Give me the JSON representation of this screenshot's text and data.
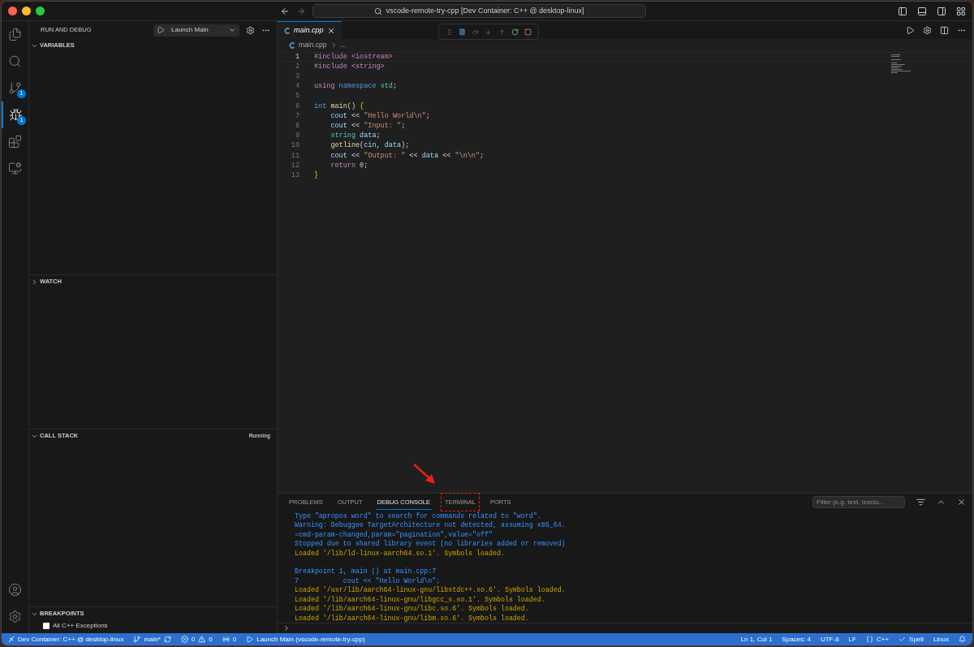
{
  "title_bar": {
    "command_center": "vscode-remote-try-cpp [Dev Container: C++ @ desktop-linux]"
  },
  "activity_bar": [
    {
      "kind": "files",
      "selected": false
    },
    {
      "kind": "search",
      "selected": false
    },
    {
      "kind": "source_control",
      "selected": false,
      "badge": "1"
    },
    {
      "kind": "run_debug",
      "selected": true,
      "badge": "1"
    },
    {
      "kind": "extensions",
      "selected": false
    },
    {
      "kind": "remote",
      "selected": false
    }
  ],
  "sidebar": {
    "title": "RUN AND DEBUG",
    "launch_config": "Launch Main",
    "sections": [
      {
        "title": "VARIABLES",
        "expanded": true,
        "kind": "variables"
      },
      {
        "title": "WATCH",
        "expanded": false,
        "kind": "watch"
      },
      {
        "title": "CALL STACK",
        "expanded": true,
        "kind": "callstack",
        "status": "Running"
      },
      {
        "title": "BREAKPOINTS",
        "expanded": true,
        "kind": "breakpoints",
        "items": [
          {
            "label": "All C++ Exceptions",
            "checked": false
          }
        ]
      }
    ]
  },
  "editor": {
    "tabs": [
      {
        "label": "main.cpp",
        "selected": true
      }
    ],
    "breadcrumb": [
      "main.cpp",
      "..."
    ],
    "lines": [
      {
        "number": "1",
        "current": true,
        "tokens": [
          {
            "text": "#include <iostream>",
            "kind": "pre"
          }
        ]
      },
      {
        "number": "2",
        "current": false,
        "tokens": [
          {
            "text": "#include <string>",
            "kind": "pre"
          }
        ]
      },
      {
        "number": "3",
        "current": false
      },
      {
        "number": "4",
        "current": false,
        "tokens": [
          {
            "text": "using",
            "kind": "ctl"
          },
          {
            "text": " namespace",
            "kind": "kw"
          },
          {
            "text": " std",
            "kind": "type"
          },
          {
            "text": ";",
            "kind": "plain"
          }
        ]
      },
      {
        "number": "5",
        "current": false
      },
      {
        "number": "6",
        "current": false,
        "tokens": [
          {
            "text": "int",
            "kind": "kw"
          },
          {
            "text": " main",
            "kind": "fn"
          },
          {
            "text": "() ",
            "kind": "plain"
          },
          {
            "text": "{",
            "kind": "brace"
          }
        ]
      },
      {
        "number": "7",
        "current": false,
        "tokens": [
          {
            "text": "    cout",
            "kind": "var"
          },
          {
            "text": " << ",
            "kind": "plain"
          },
          {
            "text": "\"Hello World\\n\"",
            "kind": "str"
          },
          {
            "text": ";",
            "kind": "plain"
          }
        ]
      },
      {
        "number": "8",
        "current": false,
        "tokens": [
          {
            "text": "    cout",
            "kind": "var"
          },
          {
            "text": " << ",
            "kind": "plain"
          },
          {
            "text": "\"Input: \"",
            "kind": "str"
          },
          {
            "text": ";",
            "kind": "plain"
          }
        ]
      },
      {
        "number": "9",
        "current": false,
        "tokens": [
          {
            "text": "    string",
            "kind": "type"
          },
          {
            "text": " data",
            "kind": "var"
          },
          {
            "text": ";",
            "kind": "plain"
          }
        ]
      },
      {
        "number": "10",
        "current": false,
        "tokens": [
          {
            "text": "    getline",
            "kind": "fn"
          },
          {
            "text": "(",
            "kind": "plain"
          },
          {
            "text": "cin",
            "kind": "var"
          },
          {
            "text": ", ",
            "kind": "plain"
          },
          {
            "text": "data",
            "kind": "var"
          },
          {
            "text": ");",
            "kind": "plain"
          }
        ]
      },
      {
        "number": "11",
        "current": false,
        "tokens": [
          {
            "text": "    cout",
            "kind": "var"
          },
          {
            "text": " << ",
            "kind": "plain"
          },
          {
            "text": "\"Output: \"",
            "kind": "str"
          },
          {
            "text": " << ",
            "kind": "plain"
          },
          {
            "text": "data",
            "kind": "var"
          },
          {
            "text": " << ",
            "kind": "plain"
          },
          {
            "text": "\"\\n\\n\"",
            "kind": "str"
          },
          {
            "text": ";",
            "kind": "plain"
          }
        ]
      },
      {
        "number": "12",
        "current": false,
        "tokens": [
          {
            "text": "    return",
            "kind": "ctl"
          },
          {
            "text": " 0",
            "kind": "num"
          },
          {
            "text": ";",
            "kind": "plain"
          }
        ]
      },
      {
        "number": "13",
        "current": false,
        "tokens": [
          {
            "text": "}",
            "kind": "brace"
          }
        ]
      }
    ]
  },
  "panel": {
    "tabs": [
      {
        "label": "PROBLEMS",
        "selected": false
      },
      {
        "label": "OUTPUT",
        "selected": false
      },
      {
        "label": "DEBUG CONSOLE",
        "selected": true
      },
      {
        "label": "TERMINAL",
        "selected": false,
        "highlighted": true
      },
      {
        "label": "PORTS",
        "selected": false
      }
    ],
    "filter": {
      "placeholder": "Filter (e.g. text, !exclu..."
    },
    "console": [
      [
        {
          "text": "Type \"apropos word\" to search for commands related to \"word\".",
          "kind": "info"
        },
        {
          "text": "Warning: Debuggee TargetArchitecture not detected, assuming x86_64.",
          "kind": "info"
        },
        {
          "text": "=cmd-param-changed,param=\"pagination\",value=\"off\"",
          "kind": "info"
        },
        {
          "text": "Stopped due to shared library event (no libraries added or removed)",
          "kind": "info"
        },
        {
          "text": "Loaded '/lib/ld-linux-aarch64.so.1'. Symbols loaded.",
          "kind": "loaded"
        }
      ],
      [
        {
          "text": "Breakpoint 1, main () at main.cpp:7",
          "kind": "info"
        },
        {
          "text": "7           cout << \"Hello World\\n\";",
          "kind": "info"
        },
        {
          "text": "Loaded '/usr/lib/aarch64-linux-gnu/libstdc++.so.6'. Symbols loaded.",
          "kind": "loaded"
        },
        {
          "text": "Loaded '/lib/aarch64-linux-gnu/libgcc_s.so.1'. Symbols loaded.",
          "kind": "loaded"
        },
        {
          "text": "Loaded '/lib/aarch64-linux-gnu/libc.so.6'. Symbols loaded.",
          "kind": "loaded"
        },
        {
          "text": "Loaded '/lib/aarch64-linux-gnu/libm.so.6'. Symbols loaded.",
          "kind": "loaded"
        }
      ]
    ]
  },
  "status_bar": {
    "remote": "Dev Container: C++ @ desktop-linux",
    "branch": "main*",
    "errors": "0",
    "warnings": "0",
    "ports": "0",
    "launch": "Launch Main (vscode-remote-try-cpp)",
    "right": [
      "Ln 1, Col 1",
      "Spaces: 4",
      "UTF-8",
      "LF",
      "C++",
      "Spell",
      "Linux"
    ]
  }
}
